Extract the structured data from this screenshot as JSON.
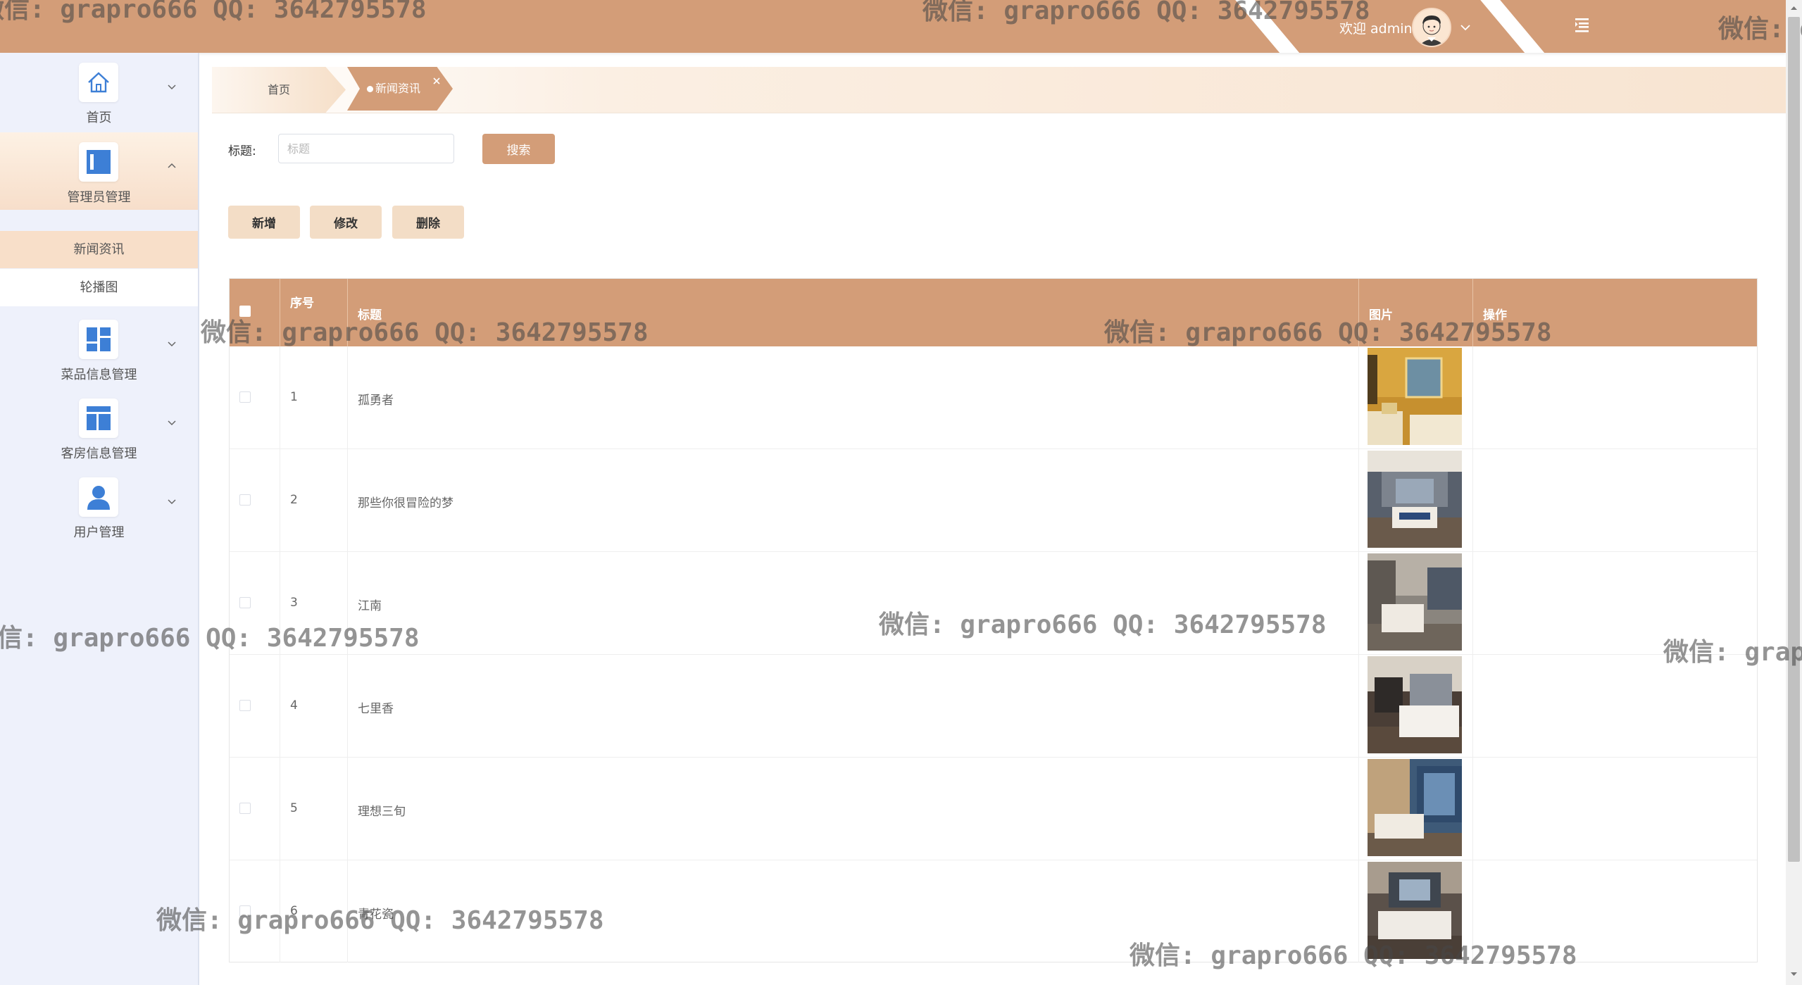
{
  "header": {
    "welcome_text": "欢迎 admin",
    "avatar_icon": "user-avatar-icon",
    "dropdown_icon": "chevron-down-icon",
    "menu_toggle_icon": "menu-fold-icon",
    "bg_color": "#d39d78"
  },
  "sidebar": {
    "items": [
      {
        "label": "首页",
        "icon": "home-icon",
        "expanded": false
      },
      {
        "label": "管理员管理",
        "icon": "admin-panel-icon",
        "expanded": true
      },
      {
        "label": "菜品信息管理",
        "icon": "dashboard-grid-icon",
        "expanded": false
      },
      {
        "label": "客房信息管理",
        "icon": "layout-icon",
        "expanded": false
      },
      {
        "label": "用户管理",
        "icon": "user-icon",
        "expanded": false
      }
    ],
    "submenu": [
      {
        "label": "新闻资讯",
        "selected": true
      },
      {
        "label": "轮播图",
        "selected": false
      }
    ]
  },
  "tabs": {
    "home": "首页",
    "active": "新闻资讯",
    "close_icon": "close-icon"
  },
  "search": {
    "label": "标题:",
    "placeholder": "标题",
    "value": "",
    "button": "搜索"
  },
  "actions": {
    "add": "新增",
    "edit": "修改",
    "delete": "删除"
  },
  "table": {
    "columns": [
      "序号",
      "标题",
      "图片",
      "操作"
    ],
    "rows": [
      {
        "index": "1",
        "title": "孤勇者"
      },
      {
        "index": "2",
        "title": "那些你很冒险的梦"
      },
      {
        "index": "3",
        "title": "江南"
      },
      {
        "index": "4",
        "title": "七里香"
      },
      {
        "index": "5",
        "title": "理想三旬"
      },
      {
        "index": "6",
        "title": "青花瓷"
      }
    ]
  },
  "watermark": "微信: grapro666 QQ: 3642795578",
  "colors": {
    "accent": "#d39d78",
    "sidebar_bg": "#eef1fb",
    "button_light": "#f3ddc6",
    "icon_blue": "#3d7fd6"
  }
}
